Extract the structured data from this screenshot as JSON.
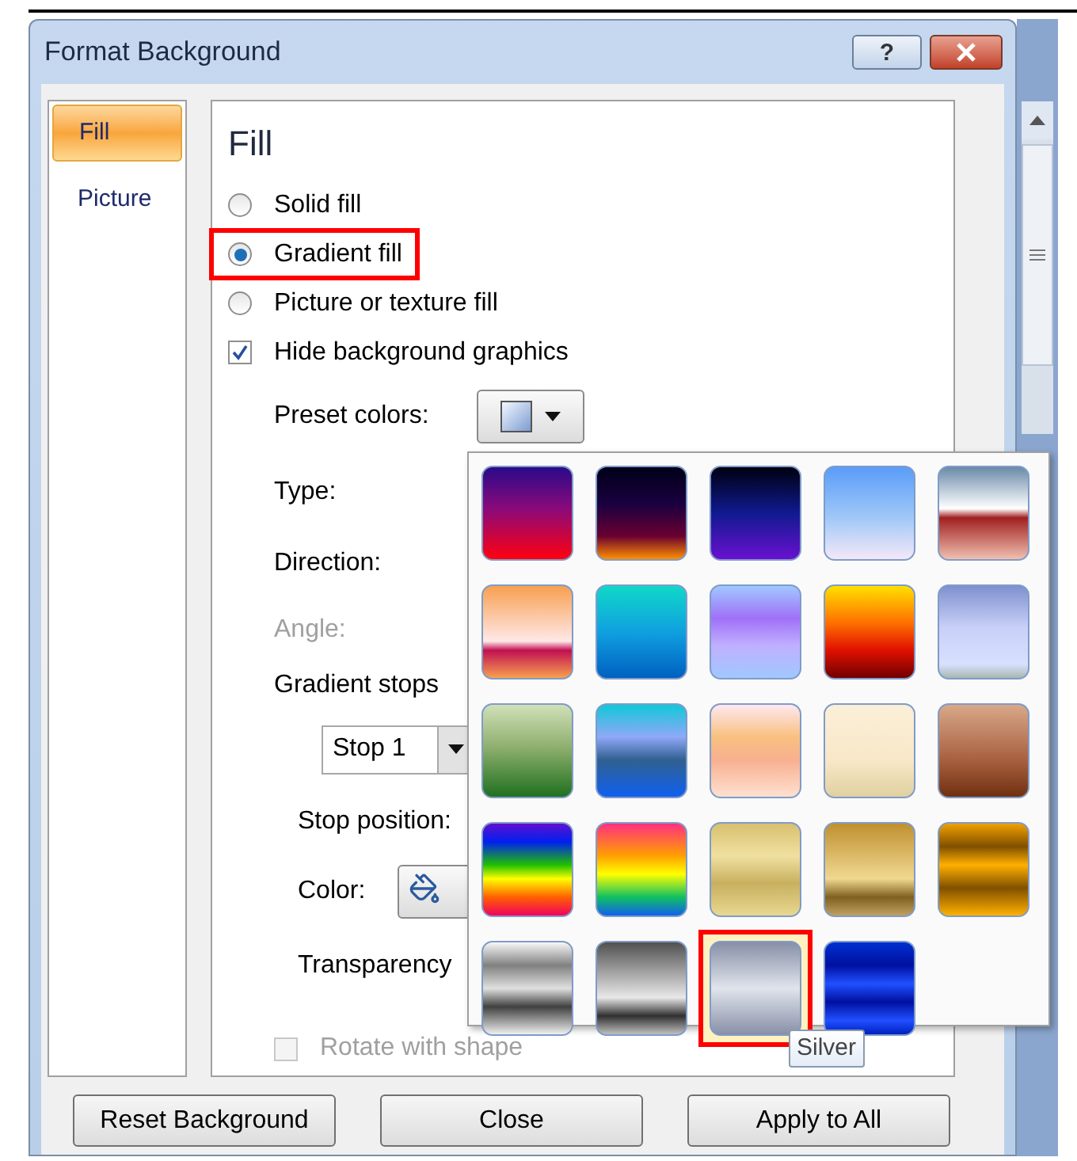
{
  "window": {
    "title": "Format Background",
    "help_button": "?"
  },
  "side_tabs": [
    {
      "label": "Fill",
      "selected": true
    },
    {
      "label": "Picture",
      "selected": false
    }
  ],
  "section_title": "Fill",
  "fill_options": [
    {
      "label": "Solid fill",
      "selected": false,
      "highlighted": false
    },
    {
      "label": "Gradient fill",
      "selected": true,
      "highlighted": true
    },
    {
      "label": "Picture or texture fill",
      "selected": false,
      "highlighted": false
    }
  ],
  "hide_graphics": {
    "label": "Hide background graphics",
    "checked": true
  },
  "preset_colors": {
    "label": "Preset colors:"
  },
  "type": {
    "label": "Type:"
  },
  "direction": {
    "label": "Direction:"
  },
  "angle": {
    "label": "Angle:",
    "disabled": true
  },
  "gradient_stops": {
    "label": "Gradient stops",
    "stop": "Stop 1"
  },
  "stop_position": {
    "label": "Stop position:"
  },
  "color": {
    "label": "Color:"
  },
  "transparency": {
    "label": "Transparency"
  },
  "rotate": {
    "label": "Rotate with shape",
    "checked": false,
    "disabled": true
  },
  "preset_swatches": [
    {
      "selected": false
    },
    {
      "selected": false
    },
    {
      "selected": false
    },
    {
      "selected": false
    },
    {
      "selected": false
    },
    {
      "selected": false
    },
    {
      "selected": false
    },
    {
      "selected": false
    },
    {
      "selected": false
    },
    {
      "selected": false
    },
    {
      "selected": false
    },
    {
      "selected": false
    },
    {
      "selected": false
    },
    {
      "selected": false
    },
    {
      "selected": false
    },
    {
      "selected": false
    },
    {
      "selected": false
    },
    {
      "selected": false
    },
    {
      "selected": false
    },
    {
      "selected": false
    },
    {
      "selected": false
    },
    {
      "selected": false
    },
    {
      "selected": true
    },
    {
      "selected": false
    }
  ],
  "tooltip": "Silver",
  "buttons": [
    "Reset Background",
    "Close",
    "Apply to All"
  ]
}
